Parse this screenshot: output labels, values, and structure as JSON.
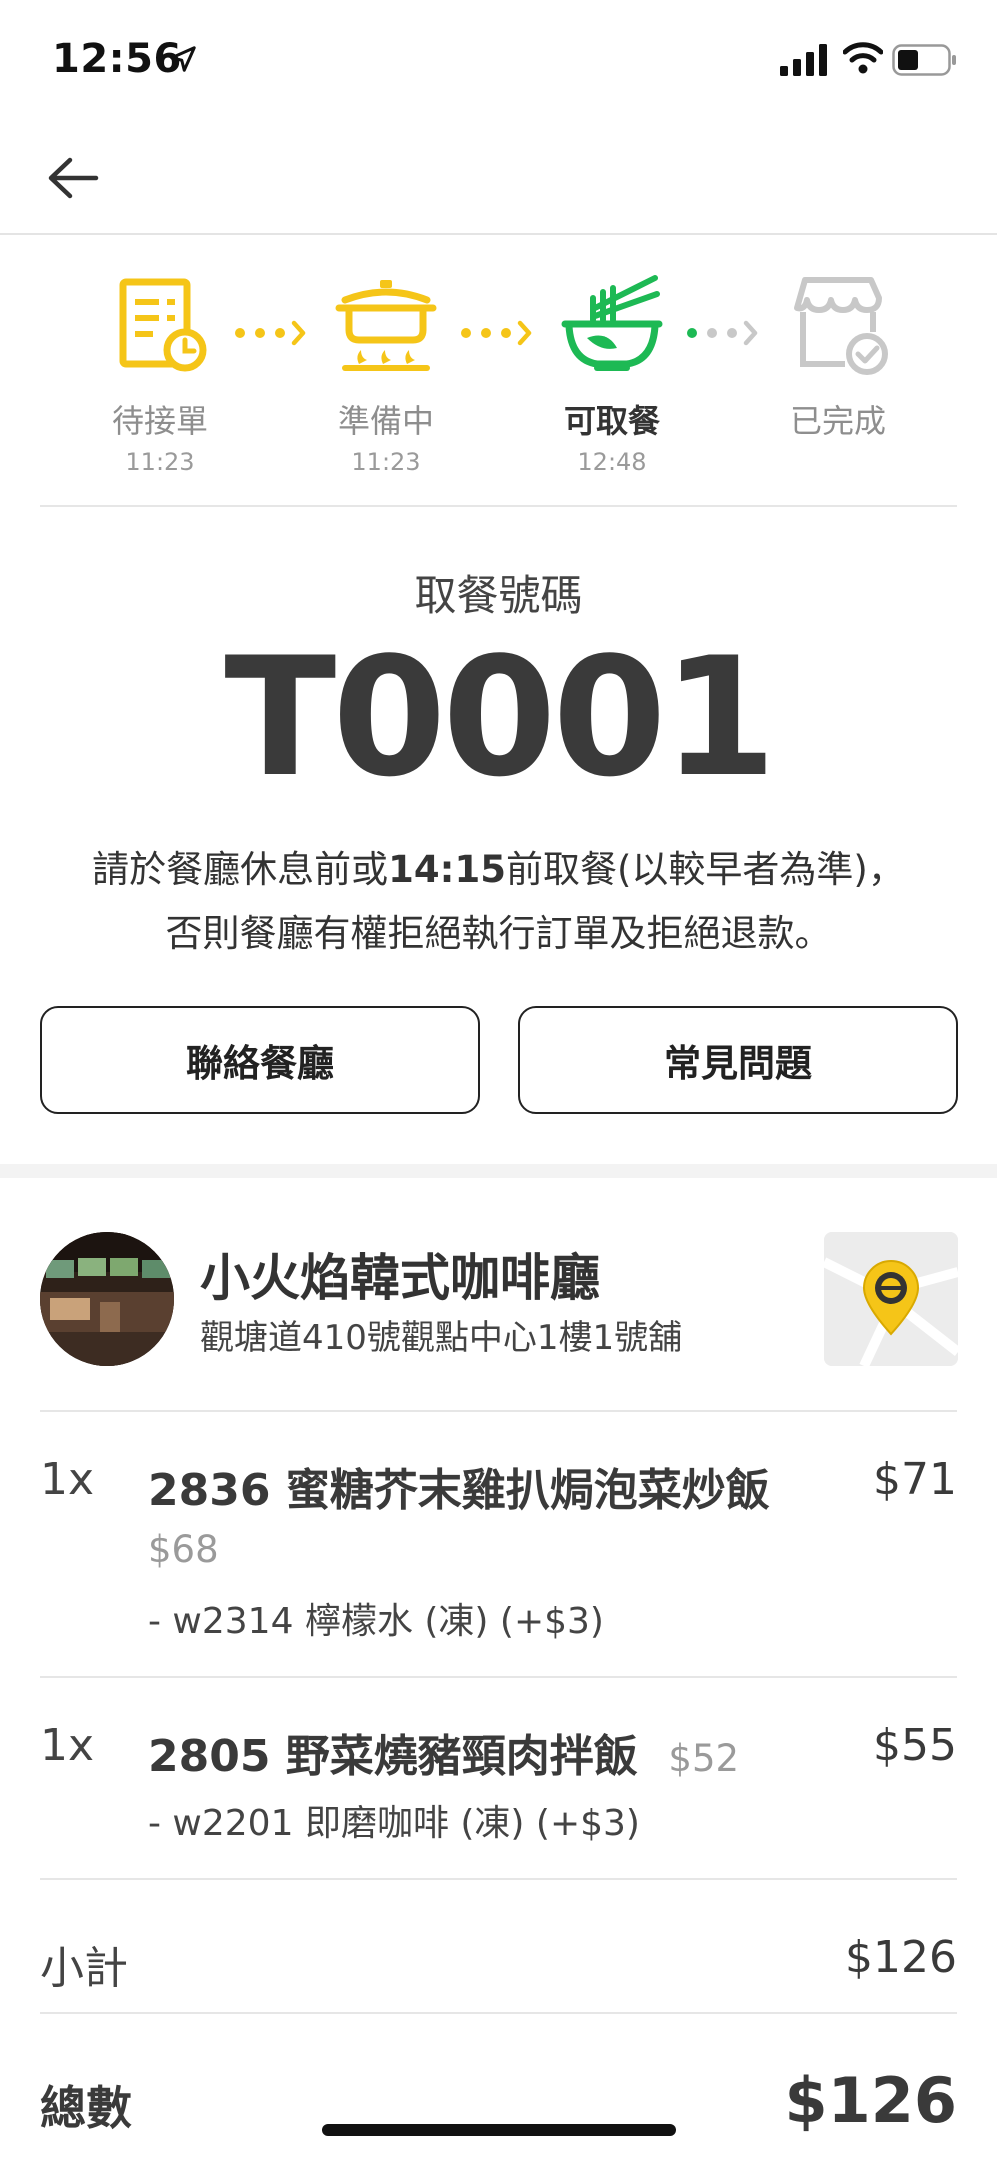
{
  "status_bar": {
    "time": "12:56"
  },
  "progress": {
    "steps": [
      {
        "label": "待接單",
        "time": "11:23",
        "icon": "order-list-clock-icon",
        "color": "#F5C518"
      },
      {
        "label": "準備中",
        "time": "11:23",
        "icon": "cooking-pot-icon",
        "color": "#F5C518"
      },
      {
        "label": "可取餐",
        "time": "12:48",
        "icon": "noodle-bowl-icon",
        "color": "#1DB954"
      },
      {
        "label": "已完成",
        "time": "",
        "icon": "store-check-icon",
        "color": "#C8C8C8"
      }
    ]
  },
  "pickup": {
    "label": "取餐號碼",
    "number": "T0001",
    "notice_part1": "請於餐廳休息前或",
    "notice_time": "14:15",
    "notice_part2": "前取餐(以較早者為準)，",
    "notice_line2": "否則餐廳有權拒絕執行訂單及拒絕退款。"
  },
  "buttons": {
    "contact": "聯絡餐廳",
    "faq": "常見問題"
  },
  "restaurant": {
    "name": "小火焰韓式咖啡廳",
    "address": "觀塘道410號觀點中心1樓1號舖"
  },
  "items": [
    {
      "qty": "1x",
      "name": "2836 蜜糖芥末雞扒焗泡菜炒飯",
      "price": "$71",
      "base_price": "$68",
      "option": "- w2314 檸檬水 (凍) (+$3)"
    },
    {
      "qty": "1x",
      "name": "2805 野菜燒豬頸肉拌飯",
      "price": "$55",
      "base_price": "$52",
      "option": "- w2201 即磨咖啡 (凍) (+$3)"
    }
  ],
  "summary": {
    "subtotal_label": "小計",
    "subtotal_value": "$126",
    "total_label": "總數",
    "total_value": "$126"
  },
  "colors": {
    "accent_yellow": "#F5C518",
    "accent_green": "#1DB954",
    "inactive": "#C8C8C8"
  }
}
